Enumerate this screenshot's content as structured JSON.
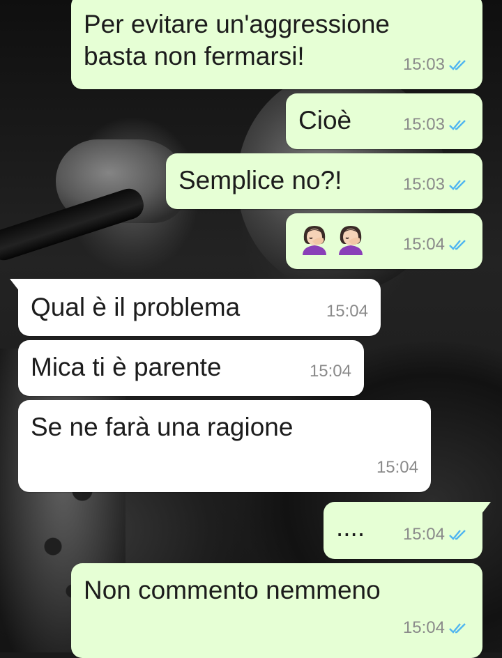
{
  "messages": [
    {
      "direction": "outgoing",
      "text": "Per evitare un'aggressione\nbasta non fermarsi!",
      "time": "15:03",
      "status": "read"
    },
    {
      "direction": "outgoing",
      "text": "Cioè",
      "time": "15:03",
      "status": "read"
    },
    {
      "direction": "outgoing",
      "text": "Semplice no?!",
      "time": "15:03",
      "status": "read"
    },
    {
      "direction": "outgoing",
      "emoji": [
        "woman-facepalming",
        "woman-facepalming"
      ],
      "time": "15:04",
      "status": "read"
    },
    {
      "direction": "incoming",
      "text": "Qual è il problema",
      "time": "15:04"
    },
    {
      "direction": "incoming",
      "text": "Mica ti è parente",
      "time": "15:04"
    },
    {
      "direction": "incoming",
      "text": "Se ne farà una ragione",
      "time": "15:04"
    },
    {
      "direction": "outgoing",
      "text": "....",
      "time": "15:04",
      "status": "read"
    },
    {
      "direction": "outgoing",
      "text": "Non commento nemmeno",
      "time": "15:04",
      "status": "read"
    }
  ],
  "colors": {
    "outgoing_bubble": "#e6ffd5",
    "incoming_bubble": "#ffffff",
    "read_tick": "#4fb5f0",
    "timestamp": "#8a8a8a"
  }
}
